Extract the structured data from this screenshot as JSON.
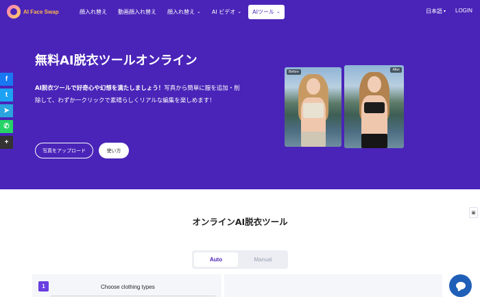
{
  "nav": {
    "logo_text": "AI Face Swap",
    "items": [
      {
        "label": "顔入れ替え",
        "has_chevron": false,
        "active": false
      },
      {
        "label": "動画顔入れ替え",
        "has_chevron": false,
        "active": false
      },
      {
        "label": "顔入れ替え",
        "has_chevron": true,
        "active": false
      },
      {
        "label": "AI ビデオ",
        "has_chevron": true,
        "active": false
      },
      {
        "label": "AIツール",
        "has_chevron": true,
        "active": true
      }
    ],
    "language": "日本語",
    "login": "LOGIN"
  },
  "hero": {
    "title": "無料AI脱衣ツールオンライン",
    "desc_bold": "AI脱衣ツールで好奇心や幻想を満たしましょう！",
    "desc_rest": "写真から簡単に服を追加・削除して、わずか一クリックで素晴らしくリアルな編集を楽しめます！",
    "upload_button": "写真をアップロード",
    "howto_button": "使い方",
    "before_badge": "Before",
    "after_badge": "After"
  },
  "social": [
    {
      "icon": "facebook-icon",
      "glyph": "f",
      "color": "#1877f2"
    },
    {
      "icon": "twitter-icon",
      "glyph": "t",
      "color": "#1da1f2"
    },
    {
      "icon": "telegram-icon",
      "glyph": "➤",
      "color": "#2aa3df"
    },
    {
      "icon": "whatsapp-icon",
      "glyph": "✆",
      "color": "#25d366"
    },
    {
      "icon": "share-plus-icon",
      "glyph": "+",
      "color": "#333333"
    }
  ],
  "section": {
    "title": "オンラインAI脱衣ツール",
    "tab_auto": "Auto",
    "tab_manual": "Manual",
    "step_number": "1",
    "step_label": "Choose clothing types"
  },
  "colors": {
    "brand": "#4a24b8",
    "step_accent": "#6a3ee0",
    "chat": "#1f5fb8"
  }
}
